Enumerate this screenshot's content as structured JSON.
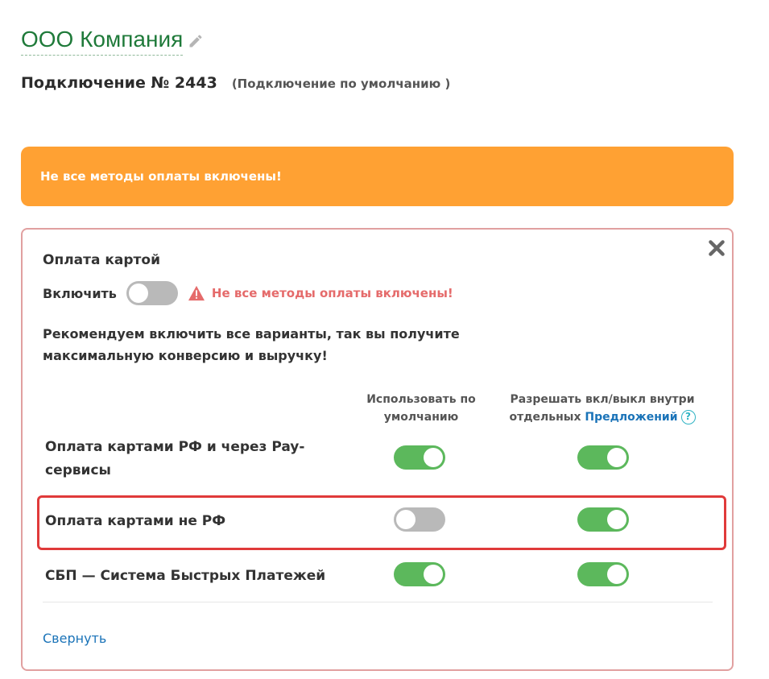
{
  "header": {
    "company_name": "ООО Компания",
    "connection_title": "Подключение № 2443",
    "connection_subtitle": "(Подключение по умолчанию )"
  },
  "alert": {
    "text": "Не все методы оплаты включены!"
  },
  "panel": {
    "title": "Оплата картой",
    "enable_label": "Включить",
    "enable_on": false,
    "warning_text": "Не все методы оплаты включены!",
    "recommendation": "Рекомендуем включить все варианты, так вы получите максимальную конверсию и выручку!",
    "column_default": "Использовать по умолчанию",
    "column_allow_prefix": "Разрешать вкл/выкл внутри отдельных",
    "column_allow_link": "Предложений",
    "help_glyph": "?",
    "methods": [
      {
        "label": "Оплата картами РФ и через Pay-сервисы",
        "default_on": true,
        "allow_on": true
      },
      {
        "label": "Оплата картами не РФ",
        "default_on": false,
        "allow_on": true
      },
      {
        "label": "СБП — Система Быстрых Платежей",
        "default_on": true,
        "allow_on": true
      }
    ],
    "collapse_label": "Свернуть"
  },
  "colors": {
    "brand_green": "#1f7a3a",
    "toggle_on": "#5cb85c",
    "toggle_off": "#b9b9b9",
    "alert_orange": "#ffa133",
    "warning_red": "#e56b6b",
    "highlight_red": "#e03a3a",
    "link_blue": "#1a73b8"
  },
  "icons": {
    "edit": "pencil-icon",
    "close": "close-icon",
    "warning": "warning-triangle-icon",
    "help": "help-circle-icon"
  }
}
